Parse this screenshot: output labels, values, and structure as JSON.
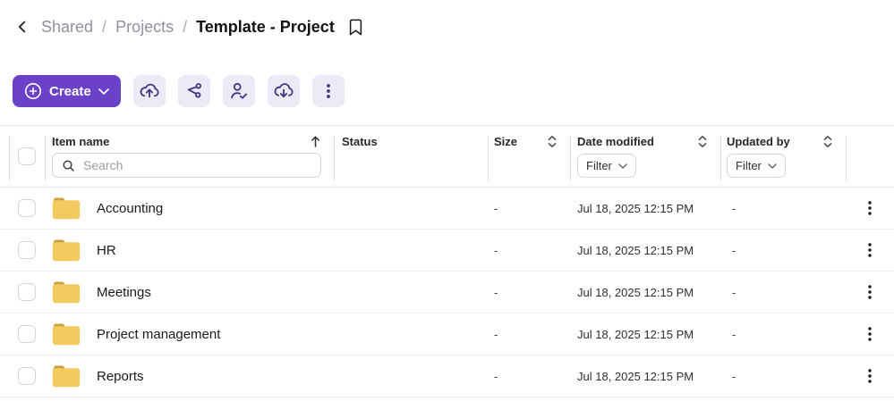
{
  "breadcrumb": {
    "separator": "/",
    "items": [
      {
        "label": "Shared"
      },
      {
        "label": "Projects"
      },
      {
        "label": "Template - Project"
      }
    ]
  },
  "toolbar": {
    "create_label": "Create",
    "icon_buttons": [
      {
        "name": "upload"
      },
      {
        "name": "share"
      },
      {
        "name": "manage-collaborators"
      },
      {
        "name": "download"
      },
      {
        "name": "more-options"
      }
    ]
  },
  "table": {
    "search_placeholder": "Search",
    "columns": [
      {
        "label": "Item name",
        "sort": "sorted-ascending"
      },
      {
        "label": "Status"
      },
      {
        "label": "Size",
        "sort": "sortable"
      },
      {
        "label": "Date modified",
        "sort": "sortable",
        "filter_label": "Filter"
      },
      {
        "label": "Updated by",
        "sort": "sortable",
        "filter_label": "Filter"
      }
    ],
    "rows": [
      {
        "icon": "folder",
        "name": "Accounting",
        "status": "",
        "size": "-",
        "date_modified": "Jul 18, 2025 12:15 PM",
        "updated_by": "-"
      },
      {
        "icon": "folder",
        "name": "HR",
        "status": "",
        "size": "-",
        "date_modified": "Jul 18, 2025 12:15 PM",
        "updated_by": "-"
      },
      {
        "icon": "folder",
        "name": "Meetings",
        "status": "",
        "size": "-",
        "date_modified": "Jul 18, 2025 12:15 PM",
        "updated_by": "-"
      },
      {
        "icon": "folder",
        "name": "Project management",
        "status": "",
        "size": "-",
        "date_modified": "Jul 18, 2025 12:15 PM",
        "updated_by": "-"
      },
      {
        "icon": "folder",
        "name": "Reports",
        "status": "",
        "size": "-",
        "date_modified": "Jul 18, 2025 12:15 PM",
        "updated_by": "-"
      }
    ]
  },
  "colors": {
    "accent_purple": "#6a41c8",
    "toolbar_button_bg": "#edeaf8",
    "toolbar_icon": "#3f3580",
    "folder_body": "#f3ca5e",
    "folder_tab": "#c9a23b"
  }
}
